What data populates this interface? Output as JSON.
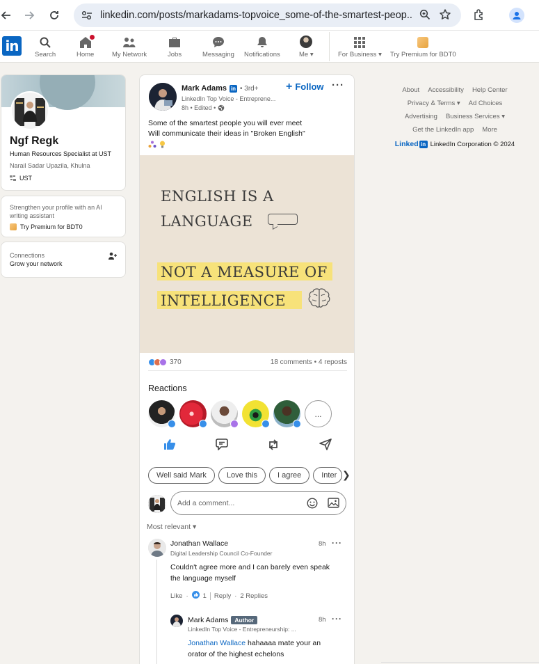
{
  "browser": {
    "url": "linkedin.com/posts/markadams-topvoice_some-of-the-smartest-peop..."
  },
  "nav": {
    "items": [
      {
        "label": "Search",
        "icon": "search-icon"
      },
      {
        "label": "Home",
        "icon": "home-icon"
      },
      {
        "label": "My Network",
        "icon": "network-icon"
      },
      {
        "label": "Jobs",
        "icon": "briefcase-icon"
      },
      {
        "label": "Messaging",
        "icon": "message-icon"
      },
      {
        "label": "Notifications",
        "icon": "bell-icon"
      },
      {
        "label": "Me",
        "icon": "avatar"
      },
      {
        "label": "For Business",
        "icon": "grid-icon"
      },
      {
        "label": "Try Premium for BDT0",
        "icon": "premium-icon"
      }
    ]
  },
  "profile": {
    "name": "Ngf Regk",
    "headline": "Human Resources Specialist at UST",
    "location": "Narail Sadar Upazila, Khulna",
    "org": "UST"
  },
  "premium_card": {
    "text": "Strengthen your profile with an AI writing assistant",
    "link": "Try Premium for BDT0"
  },
  "connections": {
    "title": "Connections",
    "subtitle": "Grow your network"
  },
  "post": {
    "author": "Mark Adams",
    "degree": "• 3rd+",
    "author_sub": "LinkedIn Top Voice - Entreprene...",
    "time": "8h • Edited •",
    "follow": "Follow",
    "text_line1": "Some of the smartest people you will ever meet",
    "text_line2": "Will communicate their ideas in \"Broken English\"",
    "image_lines": [
      "ENGLISH IS A",
      "LANGUAGE",
      "NOT A MEASURE OF",
      "INTELLIGENCE"
    ],
    "reaction_count": "370",
    "comments_reposts": "18 comments • 4 reposts",
    "reactions_title": "Reactions",
    "more_reactions": "...",
    "suggestions": [
      "Well said Mark",
      "Love this",
      "I agree",
      "Inter"
    ],
    "comment_placeholder": "Add a comment...",
    "sort_label": "Most relevant"
  },
  "comments": [
    {
      "name": "Jonathan Wallace",
      "sub": "Digital Leadership Council Co-Founder",
      "time": "8h",
      "text_line1": "Couldn't agree more and I can barely even speak",
      "text_line2": "the language myself",
      "like": "Like",
      "like_count": "1",
      "reply": "Reply",
      "replies": "2 Replies"
    }
  ],
  "reply": {
    "name": "Mark Adams",
    "badge": "Author",
    "sub": "LinkedIn Top Voice - Entrepreneurship: ...",
    "time": "8h",
    "mention": "Jonathan Wallace",
    "text_line1": " hahaaaa mate your an",
    "text_line2": "orator of the highest echelons"
  },
  "footer": {
    "links": [
      "About",
      "Accessibility",
      "Help Center",
      "Privacy & Terms",
      "Ad Choices",
      "Advertising",
      "Business Services",
      "Get the LinkedIn app",
      "More"
    ],
    "brand": "Linked",
    "brand_in": "in",
    "copyright": "LinkedIn Corporation © 2024"
  },
  "colors": {
    "brand": "#0a66c2",
    "highlight": "#f7e27a",
    "background": "#f4f2ee"
  }
}
